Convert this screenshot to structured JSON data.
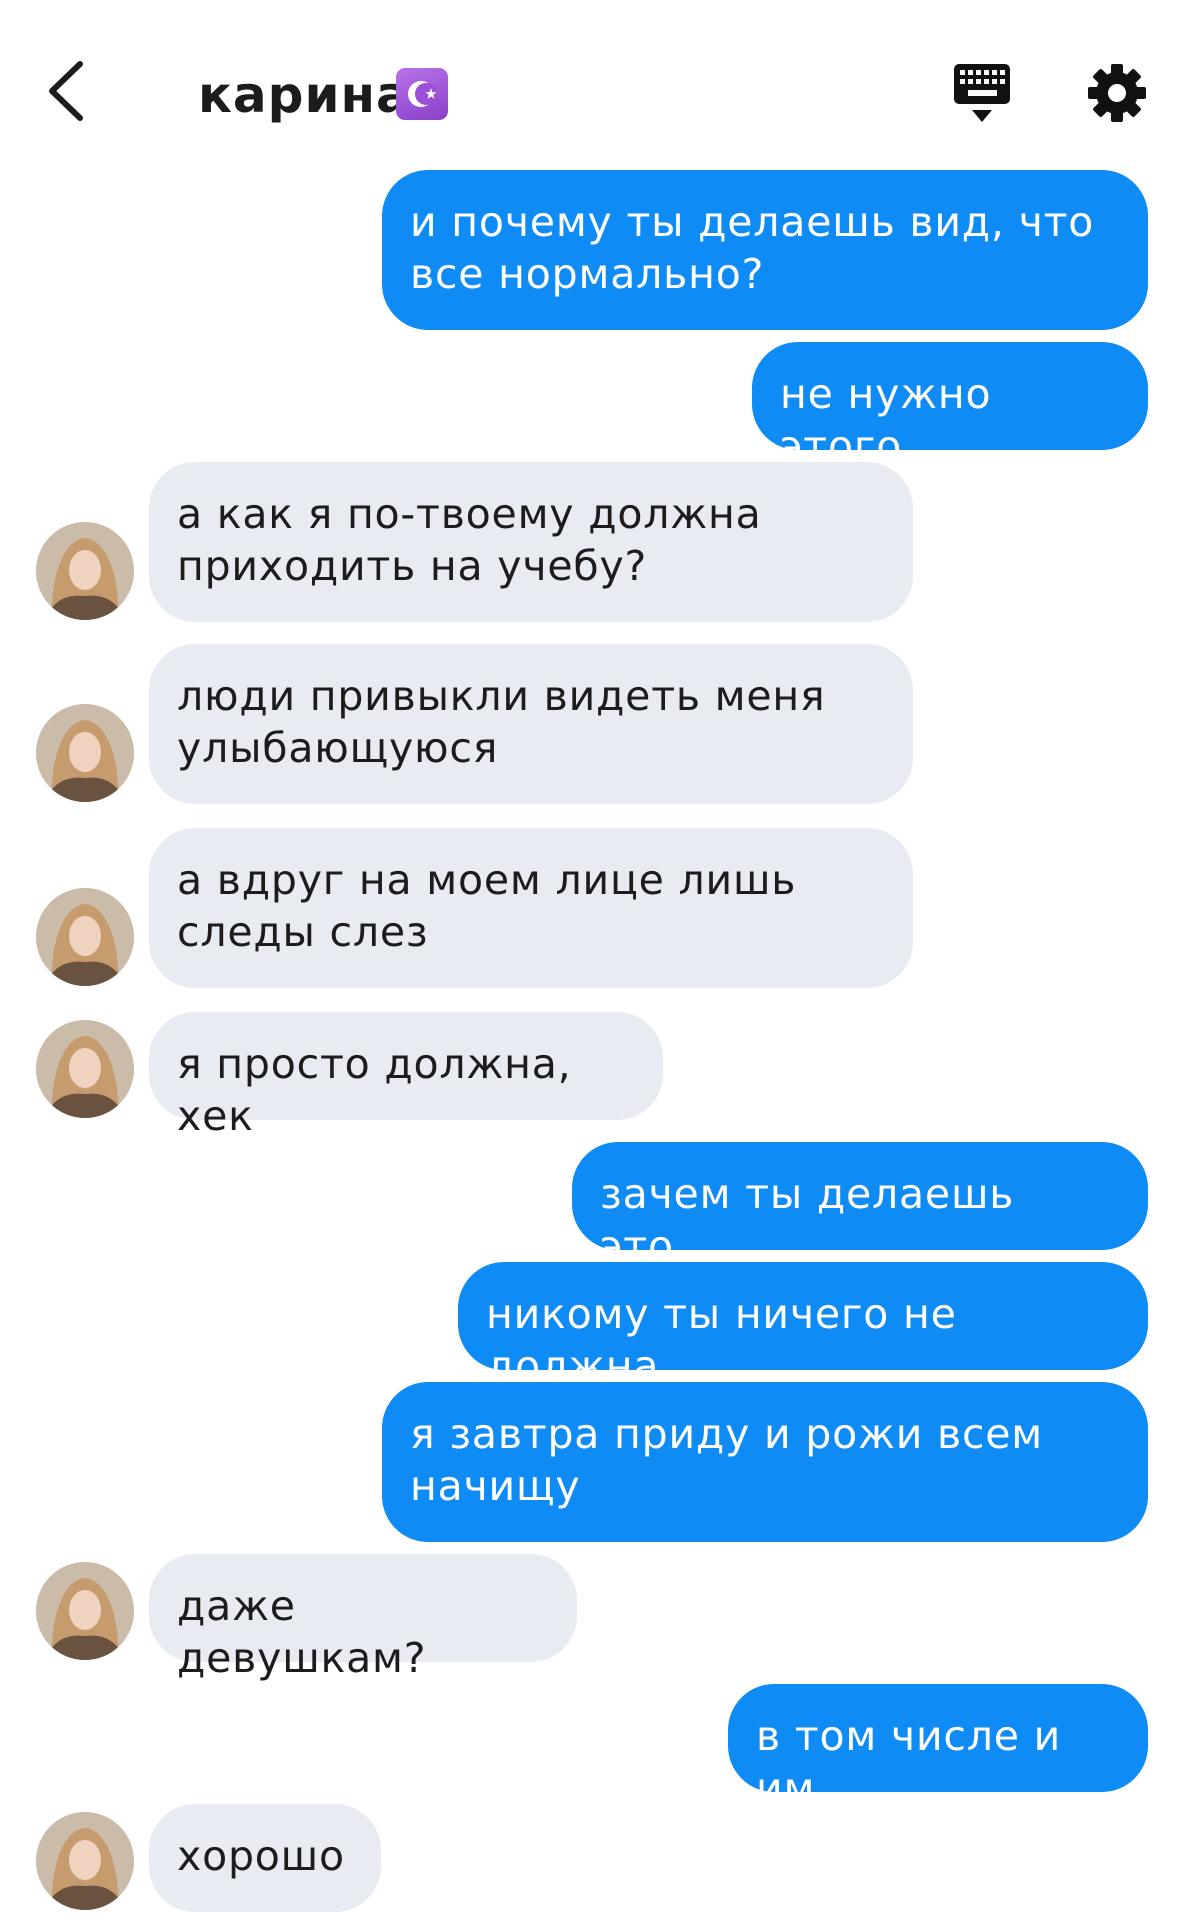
{
  "header": {
    "back_icon": "chevron-left-icon",
    "contact_name": "карина",
    "badge_icon": "star-and-crescent-emoji",
    "keyboard_icon": "keyboard-icon",
    "settings_icon": "gear-icon"
  },
  "colors": {
    "outgoing_bubble": "#0f8bf5",
    "incoming_bubble": "#e8ebf2",
    "text_dark": "#1c1c1e",
    "text_light": "#ffffff"
  },
  "messages": [
    {
      "dir": "out",
      "text": "и почему ты делаешь вид, что\nвсе нормально?"
    },
    {
      "dir": "out",
      "text": "не нужно этого"
    },
    {
      "dir": "in",
      "text": "а как я по-твоему должна\nприходить на учебу?"
    },
    {
      "dir": "in",
      "text": "люди привыкли видеть меня\nулыбающуюся"
    },
    {
      "dir": "in",
      "text": "а вдруг на моем лице лишь\nследы слез"
    },
    {
      "dir": "in",
      "text": "я просто должна, хек"
    },
    {
      "dir": "out",
      "text": "зачем ты делаешь это..."
    },
    {
      "dir": "out",
      "text": "никому ты ничего не должна"
    },
    {
      "dir": "out",
      "text": "я завтра приду и рожи всем\nначищу"
    },
    {
      "dir": "in",
      "text": "даже девушкам?"
    },
    {
      "dir": "out",
      "text": "в том числе и им"
    },
    {
      "dir": "in",
      "text": "хорошо"
    }
  ]
}
